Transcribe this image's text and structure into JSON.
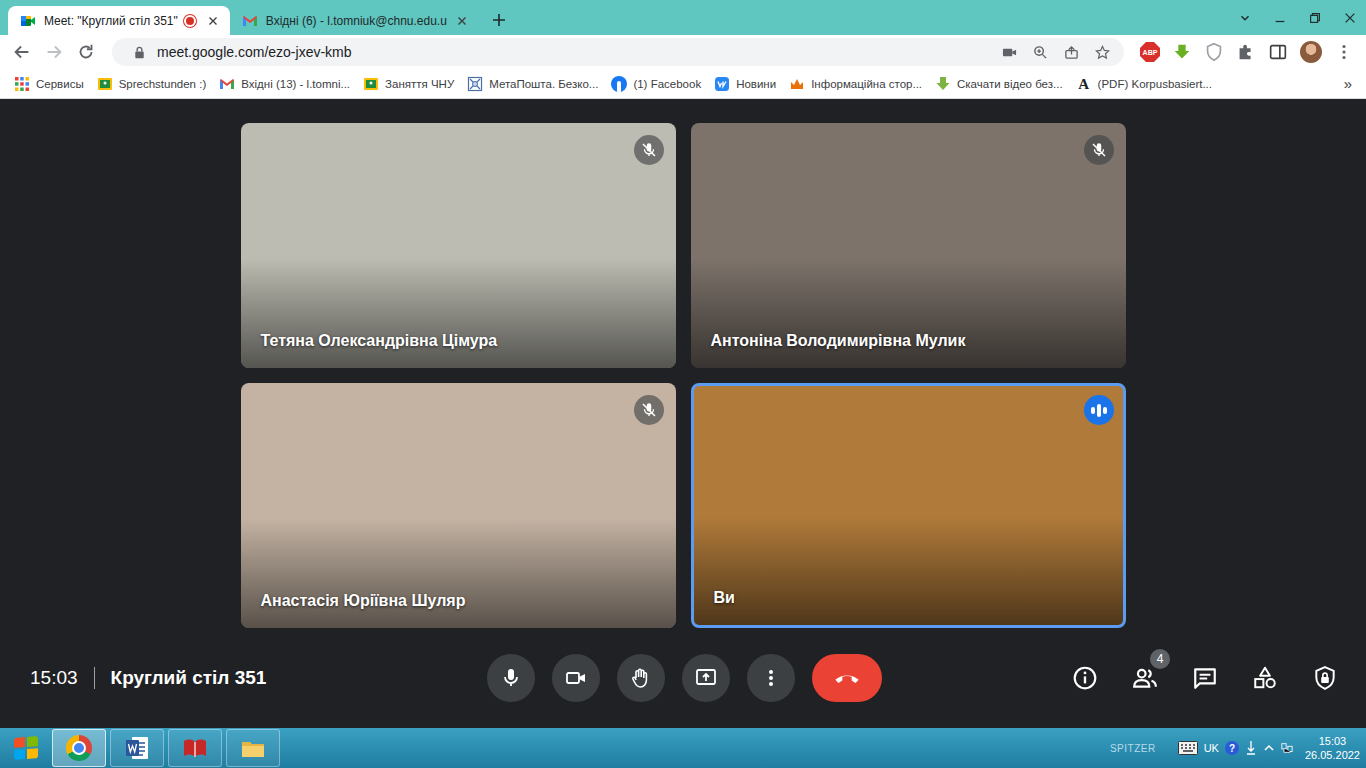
{
  "browser": {
    "tabs": [
      {
        "title": "Meet: \"Круглий стіл 351\"",
        "selected": true,
        "recording": true,
        "kind": "meet"
      },
      {
        "title": "Вхідні (6) - l.tomniuk@chnu.edu.u",
        "selected": false,
        "recording": false,
        "kind": "gmail"
      }
    ],
    "url": "meet.google.com/ezo-jxev-kmb",
    "forward_disabled": true,
    "extension_badge": "ABP",
    "bookmarks": [
      {
        "label": "Сервисы",
        "kind": "apps"
      },
      {
        "label": "Sprechstunden :)",
        "kind": "classroom"
      },
      {
        "label": "Вхідні (13) - l.tomni...",
        "kind": "gmail"
      },
      {
        "label": "Заняття ЧНУ",
        "kind": "classroom"
      },
      {
        "label": "МетаПошта. Безко...",
        "kind": "meta"
      },
      {
        "label": "(1) Facebook",
        "kind": "facebook"
      },
      {
        "label": "Новини",
        "kind": "vk"
      },
      {
        "label": "Інформаційна стор...",
        "kind": "info"
      },
      {
        "label": "Скачати відео без...",
        "kind": "download"
      },
      {
        "label": "(PDF) Korpusbasiert...",
        "kind": "letter",
        "glyph": "A"
      }
    ],
    "bookmarks_more": "»"
  },
  "meeting": {
    "participants": [
      {
        "name": "Тетяна Олександрівна Цімура",
        "muted": true,
        "speaking": false,
        "color": "#bdbcb2"
      },
      {
        "name": "Антоніна Володимирівна Мулик",
        "muted": true,
        "speaking": false,
        "color": "#7d736b"
      },
      {
        "name": "Анастасія Юріївна Шуляр",
        "muted": true,
        "speaking": false,
        "color": "#c4b3a3"
      },
      {
        "name": "Ви",
        "muted": false,
        "speaking": true,
        "color": "#b07a3a"
      }
    ],
    "time": "15:03",
    "title": "Круглий стіл 351",
    "people_count": "4",
    "controls": {
      "mic_on": true,
      "camera_on": true
    }
  },
  "taskbar": {
    "apps": [
      {
        "kind": "chrome",
        "active": true
      },
      {
        "kind": "word",
        "active": false
      },
      {
        "kind": "reader",
        "active": false
      },
      {
        "kind": "explorer",
        "active": false
      }
    ],
    "watermark": "SPITZER",
    "language": "UK",
    "help": "?",
    "time": "15:03",
    "date": "26.05.2022"
  }
}
